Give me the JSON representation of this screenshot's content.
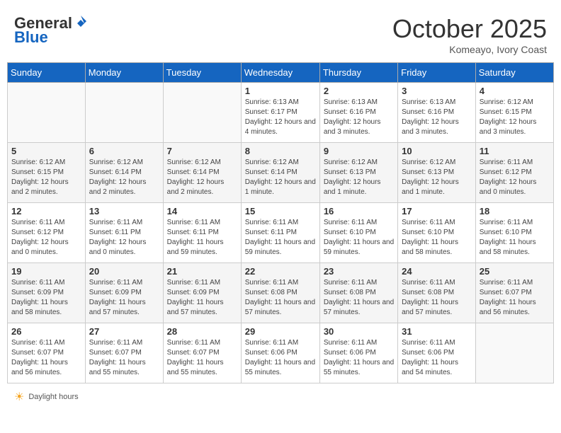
{
  "header": {
    "logo_general": "General",
    "logo_blue": "Blue",
    "month": "October 2025",
    "location": "Komeayo, Ivory Coast"
  },
  "days_of_week": [
    "Sunday",
    "Monday",
    "Tuesday",
    "Wednesday",
    "Thursday",
    "Friday",
    "Saturday"
  ],
  "weeks": [
    [
      {
        "day": "",
        "empty": true
      },
      {
        "day": "",
        "empty": true
      },
      {
        "day": "",
        "empty": true
      },
      {
        "day": "1",
        "sunrise": "6:13 AM",
        "sunset": "6:17 PM",
        "daylight": "12 hours and 4 minutes."
      },
      {
        "day": "2",
        "sunrise": "6:13 AM",
        "sunset": "6:16 PM",
        "daylight": "12 hours and 3 minutes."
      },
      {
        "day": "3",
        "sunrise": "6:13 AM",
        "sunset": "6:16 PM",
        "daylight": "12 hours and 3 minutes."
      },
      {
        "day": "4",
        "sunrise": "6:12 AM",
        "sunset": "6:15 PM",
        "daylight": "12 hours and 3 minutes."
      }
    ],
    [
      {
        "day": "5",
        "sunrise": "6:12 AM",
        "sunset": "6:15 PM",
        "daylight": "12 hours and 2 minutes."
      },
      {
        "day": "6",
        "sunrise": "6:12 AM",
        "sunset": "6:14 PM",
        "daylight": "12 hours and 2 minutes."
      },
      {
        "day": "7",
        "sunrise": "6:12 AM",
        "sunset": "6:14 PM",
        "daylight": "12 hours and 2 minutes."
      },
      {
        "day": "8",
        "sunrise": "6:12 AM",
        "sunset": "6:14 PM",
        "daylight": "12 hours and 1 minute."
      },
      {
        "day": "9",
        "sunrise": "6:12 AM",
        "sunset": "6:13 PM",
        "daylight": "12 hours and 1 minute."
      },
      {
        "day": "10",
        "sunrise": "6:12 AM",
        "sunset": "6:13 PM",
        "daylight": "12 hours and 1 minute."
      },
      {
        "day": "11",
        "sunrise": "6:11 AM",
        "sunset": "6:12 PM",
        "daylight": "12 hours and 0 minutes."
      }
    ],
    [
      {
        "day": "12",
        "sunrise": "6:11 AM",
        "sunset": "6:12 PM",
        "daylight": "12 hours and 0 minutes."
      },
      {
        "day": "13",
        "sunrise": "6:11 AM",
        "sunset": "6:11 PM",
        "daylight": "12 hours and 0 minutes."
      },
      {
        "day": "14",
        "sunrise": "6:11 AM",
        "sunset": "6:11 PM",
        "daylight": "11 hours and 59 minutes."
      },
      {
        "day": "15",
        "sunrise": "6:11 AM",
        "sunset": "6:11 PM",
        "daylight": "11 hours and 59 minutes."
      },
      {
        "day": "16",
        "sunrise": "6:11 AM",
        "sunset": "6:10 PM",
        "daylight": "11 hours and 59 minutes."
      },
      {
        "day": "17",
        "sunrise": "6:11 AM",
        "sunset": "6:10 PM",
        "daylight": "11 hours and 58 minutes."
      },
      {
        "day": "18",
        "sunrise": "6:11 AM",
        "sunset": "6:10 PM",
        "daylight": "11 hours and 58 minutes."
      }
    ],
    [
      {
        "day": "19",
        "sunrise": "6:11 AM",
        "sunset": "6:09 PM",
        "daylight": "11 hours and 58 minutes."
      },
      {
        "day": "20",
        "sunrise": "6:11 AM",
        "sunset": "6:09 PM",
        "daylight": "11 hours and 57 minutes."
      },
      {
        "day": "21",
        "sunrise": "6:11 AM",
        "sunset": "6:09 PM",
        "daylight": "11 hours and 57 minutes."
      },
      {
        "day": "22",
        "sunrise": "6:11 AM",
        "sunset": "6:08 PM",
        "daylight": "11 hours and 57 minutes."
      },
      {
        "day": "23",
        "sunrise": "6:11 AM",
        "sunset": "6:08 PM",
        "daylight": "11 hours and 57 minutes."
      },
      {
        "day": "24",
        "sunrise": "6:11 AM",
        "sunset": "6:08 PM",
        "daylight": "11 hours and 57 minutes."
      },
      {
        "day": "25",
        "sunrise": "6:11 AM",
        "sunset": "6:07 PM",
        "daylight": "11 hours and 56 minutes."
      }
    ],
    [
      {
        "day": "26",
        "sunrise": "6:11 AM",
        "sunset": "6:07 PM",
        "daylight": "11 hours and 56 minutes."
      },
      {
        "day": "27",
        "sunrise": "6:11 AM",
        "sunset": "6:07 PM",
        "daylight": "11 hours and 55 minutes."
      },
      {
        "day": "28",
        "sunrise": "6:11 AM",
        "sunset": "6:07 PM",
        "daylight": "11 hours and 55 minutes."
      },
      {
        "day": "29",
        "sunrise": "6:11 AM",
        "sunset": "6:06 PM",
        "daylight": "11 hours and 55 minutes."
      },
      {
        "day": "30",
        "sunrise": "6:11 AM",
        "sunset": "6:06 PM",
        "daylight": "11 hours and 55 minutes."
      },
      {
        "day": "31",
        "sunrise": "6:11 AM",
        "sunset": "6:06 PM",
        "daylight": "11 hours and 54 minutes."
      },
      {
        "day": "",
        "empty": true
      }
    ]
  ],
  "footer": {
    "daylight_label": "Daylight hours"
  }
}
